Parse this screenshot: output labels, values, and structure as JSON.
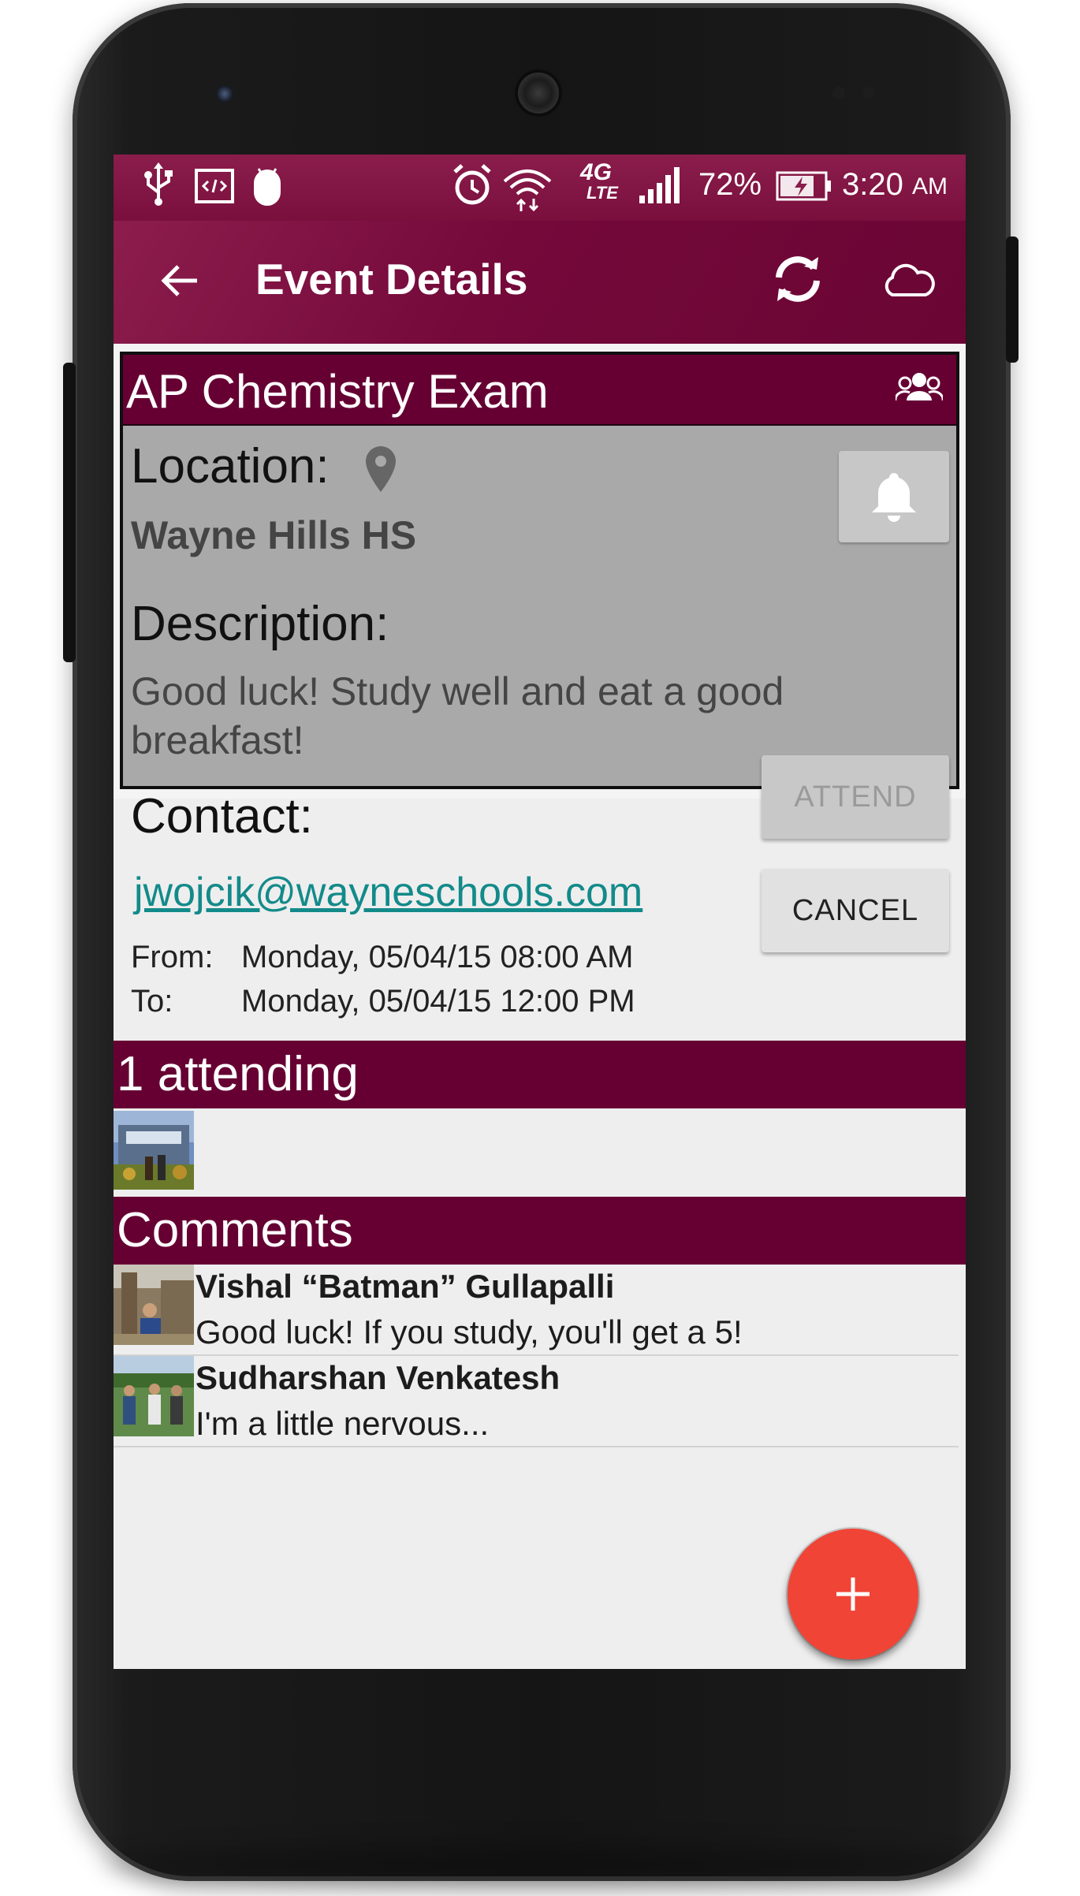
{
  "status_bar": {
    "battery_percent": "72%",
    "time": "3:20",
    "ampm": "AM",
    "network": "4G",
    "network_sub": "LTE"
  },
  "toolbar": {
    "title": "Event Details",
    "icons": [
      "back-arrow-icon",
      "sync-icon",
      "cloud-icon"
    ]
  },
  "event": {
    "title": "AP Chemistry Exam",
    "location_label": "Location:",
    "location_value": "Wayne Hills HS",
    "description_label": "Description:",
    "description_value": "Good luck! Study well and eat a good breakfast!",
    "contact_label": "Contact:",
    "contact_email": "jwojcik@wayneschools.com",
    "from_label": "From:",
    "from_value": "Monday, 05/04/15 08:00 AM",
    "to_label": "To:",
    "to_value": "Monday, 05/04/15 12:00 PM",
    "attend_label": "ATTEND",
    "cancel_label": "CANCEL"
  },
  "attending": {
    "header": "1 attending"
  },
  "comments": {
    "header": "Comments",
    "items": [
      {
        "author": "Vishal “Batman” Gullapalli",
        "text": "Good luck! If you study, you'll get a 5!"
      },
      {
        "author": "Sudharshan Venkatesh",
        "text": "I'm a little nervous..."
      }
    ]
  },
  "colors": {
    "primary": "#660033",
    "toolbar": "#7a0f3d",
    "card_bg": "#a9a9a9",
    "link": "#138a8a",
    "fab": "#f04436"
  }
}
